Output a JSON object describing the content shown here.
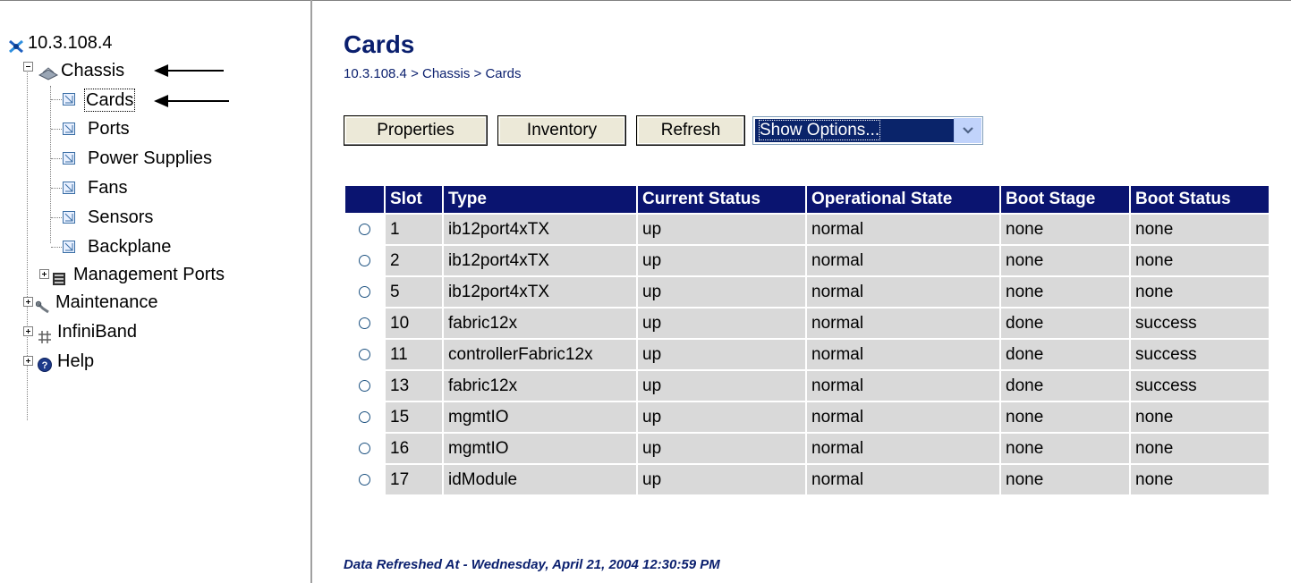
{
  "tree": {
    "root": "10.3.108.4",
    "chassis": "Chassis",
    "children": [
      "Cards",
      "Ports",
      "Power Supplies",
      "Fans",
      "Sensors",
      "Backplane"
    ],
    "management_ports": "Management Ports",
    "maintenance": "Maintenance",
    "infiniband": "InfiniBand",
    "help": "Help"
  },
  "page": {
    "title": "Cards",
    "breadcrumb": "10.3.108.4 > Chassis > Cards"
  },
  "toolbar": {
    "properties_label": "Properties",
    "inventory_label": "Inventory",
    "refresh_label": "Refresh",
    "show_options_value": "Show Options..."
  },
  "table": {
    "headers": [
      "",
      "Slot",
      "Type",
      "Current Status",
      "Operational State",
      "Boot Stage",
      "Boot Status"
    ],
    "rows": [
      [
        "1",
        "ib12port4xTX",
        "up",
        "normal",
        "none",
        "none"
      ],
      [
        "2",
        "ib12port4xTX",
        "up",
        "normal",
        "none",
        "none"
      ],
      [
        "5",
        "ib12port4xTX",
        "up",
        "normal",
        "none",
        "none"
      ],
      [
        "10",
        "fabric12x",
        "up",
        "normal",
        "done",
        "success"
      ],
      [
        "11",
        "controllerFabric12x",
        "up",
        "normal",
        "done",
        "success"
      ],
      [
        "13",
        "fabric12x",
        "up",
        "normal",
        "done",
        "success"
      ],
      [
        "15",
        "mgmtIO",
        "up",
        "normal",
        "none",
        "none"
      ],
      [
        "16",
        "mgmtIO",
        "up",
        "normal",
        "none",
        "none"
      ],
      [
        "17",
        "idModule",
        "up",
        "normal",
        "none",
        "none"
      ]
    ]
  },
  "footer": "Data Refreshed At - Wednesday, April 21, 2004 12:30:59 PM",
  "colors": {
    "header_bg": "#0a1470",
    "cell_bg": "#d9d9d9",
    "title": "#0a1f6e",
    "select_highlight": "#0a246a"
  },
  "icons": [
    "network-device-icon",
    "chassis-icon",
    "document-icon",
    "rack-icon",
    "wrench-icon",
    "hash-icon",
    "help-icon"
  ]
}
